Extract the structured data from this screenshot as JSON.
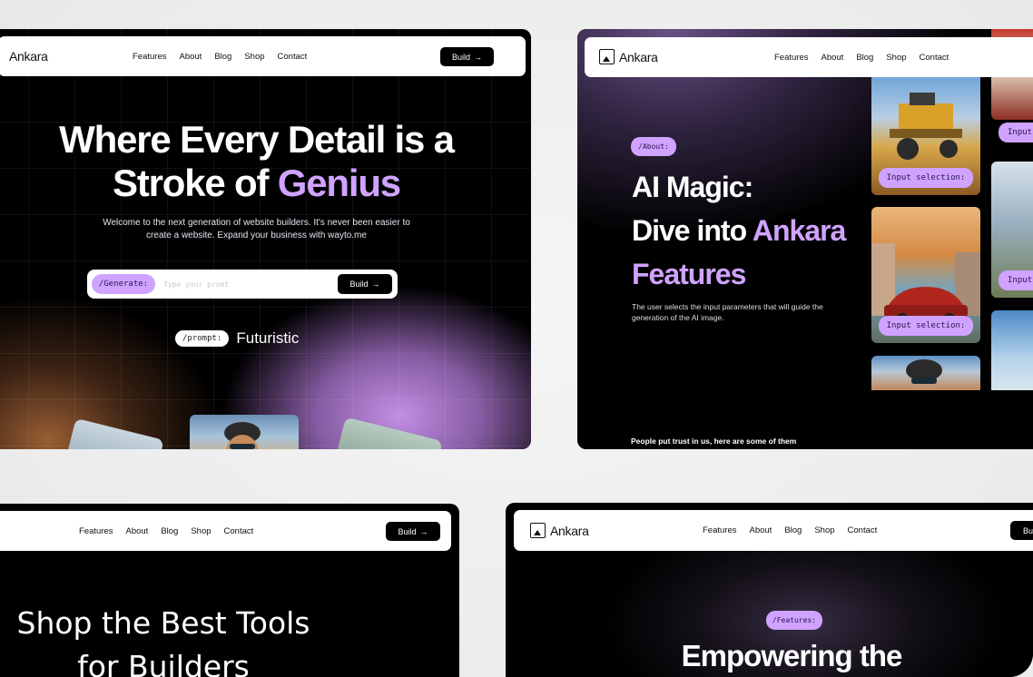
{
  "nav": {
    "brand": "Ankara",
    "links": [
      "Features",
      "About",
      "Blog",
      "Shop",
      "Contact"
    ],
    "build_label": "Build"
  },
  "card1": {
    "title_line1": "Where Every Detail is a",
    "title_line2_plain": "Stroke of",
    "title_line2_accent": "Genius",
    "subtitle": "Welcome to the next generation of website builders. It's never been easier to create a website. Expand your business with wayto.me",
    "generate_tag": "/Generate:",
    "prompt_placeholder": "Type your promt",
    "build_label": "Build",
    "prompt_tag": "/prompt:",
    "prompt_value": "Futuristic"
  },
  "card2": {
    "tag": "/About:",
    "title_line1": "AI Magic:",
    "title_line2_plain": "Dive into",
    "title_line2_accent": "Ankara",
    "title_line3_accent": "Features",
    "description": "The user selects the input parameters that will guide the generation of the AI image.",
    "selection_label": "Input selection:",
    "selection_label_cut": "Input",
    "trust_text": "People put trust in us, here are some of them"
  },
  "card3": {
    "title_line1": "Shop the Best Tools",
    "title_line2": "for Builders"
  },
  "card4": {
    "tag": "/Features:",
    "title": "Empowering the",
    "build_label_cut": "Bu"
  },
  "colors": {
    "accent": "#cfa3ff",
    "background": "#ededed",
    "card": "#000000"
  }
}
